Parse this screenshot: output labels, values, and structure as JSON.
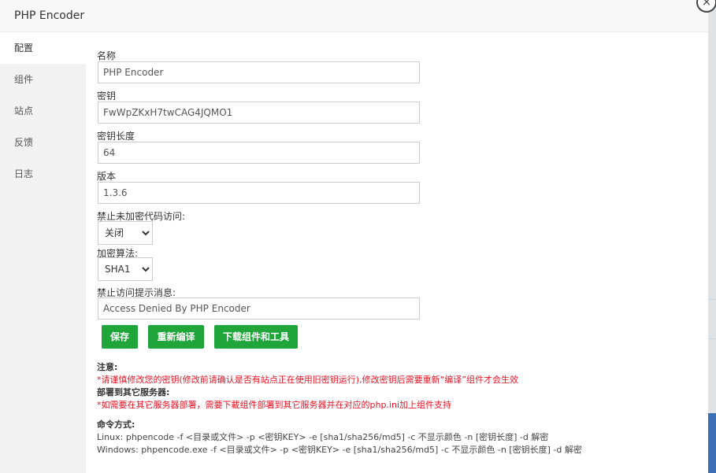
{
  "window": {
    "title": "PHP Encoder",
    "close_icon": "×"
  },
  "sidebar": {
    "items": [
      {
        "label": "配置",
        "active": true
      },
      {
        "label": "组件"
      },
      {
        "label": "站点"
      },
      {
        "label": "反馈"
      },
      {
        "label": "日志"
      }
    ]
  },
  "form": {
    "name_label": "名称",
    "name_value": "PHP Encoder",
    "key_label": "密钥",
    "key_value": "FwWpZKxH7twCAG4JQMO1",
    "key_length_label": "密钥长度",
    "key_length_value": "64",
    "version_label": "版本",
    "version_value": "1.3.6",
    "block_unencrypted_label": "禁止未加密代码访问:",
    "block_unencrypted_value": "关闭",
    "algorithm_label": "加密算法:",
    "algorithm_value": "SHA1",
    "deny_message_label": "禁止访问提示消息:",
    "deny_message_value": "Access Denied By PHP Encoder"
  },
  "buttons": {
    "save": "保存",
    "recompile": "重新编译",
    "download": "下载组件和工具"
  },
  "notes": {
    "attention_head": "注意:",
    "attention_text": "*请谨慎修改您的密钥(修改前请确认是否有站点正在使用旧密钥运行),修改密钥后需要重新“编译”组件才会生效",
    "deploy_head": "部署到其它服务器:",
    "deploy_text": "*如需要在其它服务器部署，需要下載组件部署到其它服务器并在对应的php.ini加上组件支持",
    "command_head": "命令方式:",
    "linux_cmd": "Linux: phpencode -f <目录或文件> -p <密钥KEY> -e [sha1/sha256/md5] -c 不显示颜色 -n [密钥长度] -d 解密",
    "windows_cmd": "Windows: phpencode.exe -f <目录或文件> -p <密钥KEY> -e [sha1/sha256/md5] -c 不显示颜色 -n [密钥长度] -d 解密"
  }
}
